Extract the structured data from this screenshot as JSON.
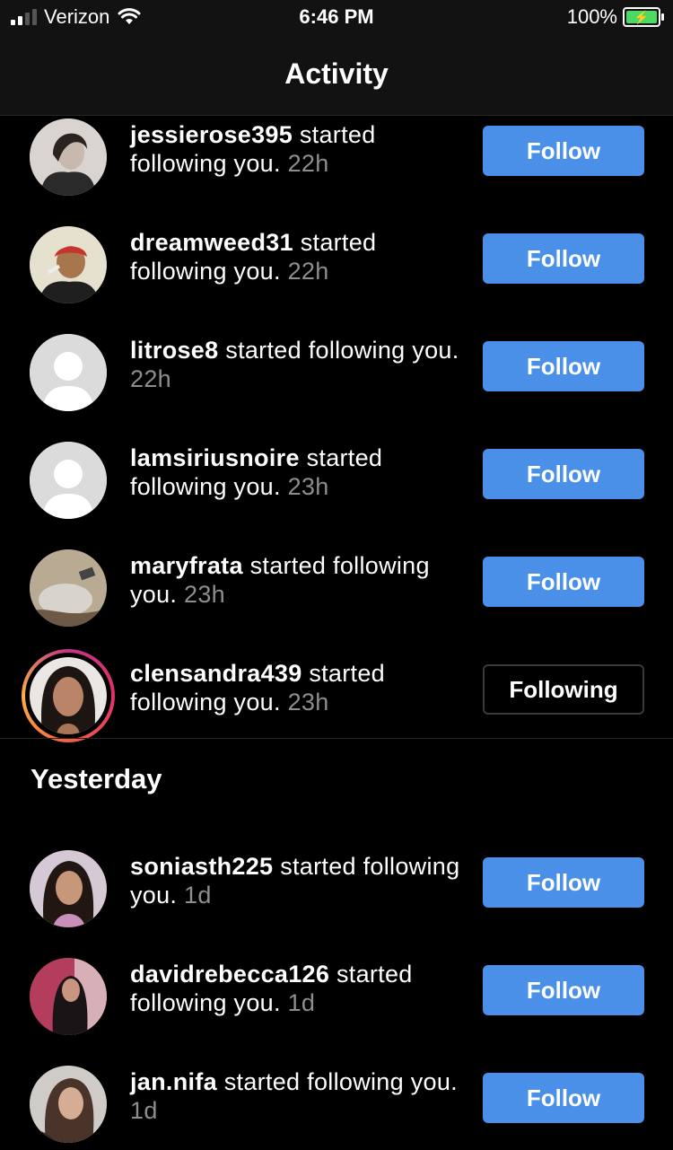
{
  "status_bar": {
    "carrier": "Verizon",
    "time": "6:46 PM",
    "battery": "100%"
  },
  "header": {
    "title": "Activity"
  },
  "rows": [
    {
      "username": "jessierose395",
      "action": "started following you.",
      "time": "22h",
      "button": "Follow",
      "avatar": "photo"
    },
    {
      "username": "dreamweed31",
      "action": "started following you.",
      "time": "22h",
      "button": "Follow",
      "avatar": "photo"
    },
    {
      "username": "litrose8",
      "action": "started following you.",
      "time": "22h",
      "button": "Follow",
      "avatar": "default"
    },
    {
      "username": "lamsiriusnoire",
      "action": "started following you.",
      "time": "23h",
      "button": "Follow",
      "avatar": "default"
    },
    {
      "username": "maryfrata",
      "action": "started following you.",
      "time": "23h",
      "button": "Follow",
      "avatar": "photo"
    },
    {
      "username": "clensandra439",
      "action": "started following you.",
      "time": "23h",
      "button": "Following",
      "avatar": "story"
    }
  ],
  "section_yesterday": {
    "title": "Yesterday"
  },
  "yesterday_rows": [
    {
      "username": "soniasth225",
      "action": "started following you.",
      "time": "1d",
      "button": "Follow",
      "avatar": "photo"
    },
    {
      "username": "davidrebecca126",
      "action": "started following you.",
      "time": "1d",
      "button": "Follow",
      "avatar": "photo"
    },
    {
      "username": "jan.nifa",
      "action": "started following you.",
      "time": "1d",
      "button": "Follow",
      "avatar": "photo"
    }
  ],
  "colors": {
    "follow_button": "#4a90e8",
    "background": "#000000",
    "time_text": "#8e8e8e"
  }
}
